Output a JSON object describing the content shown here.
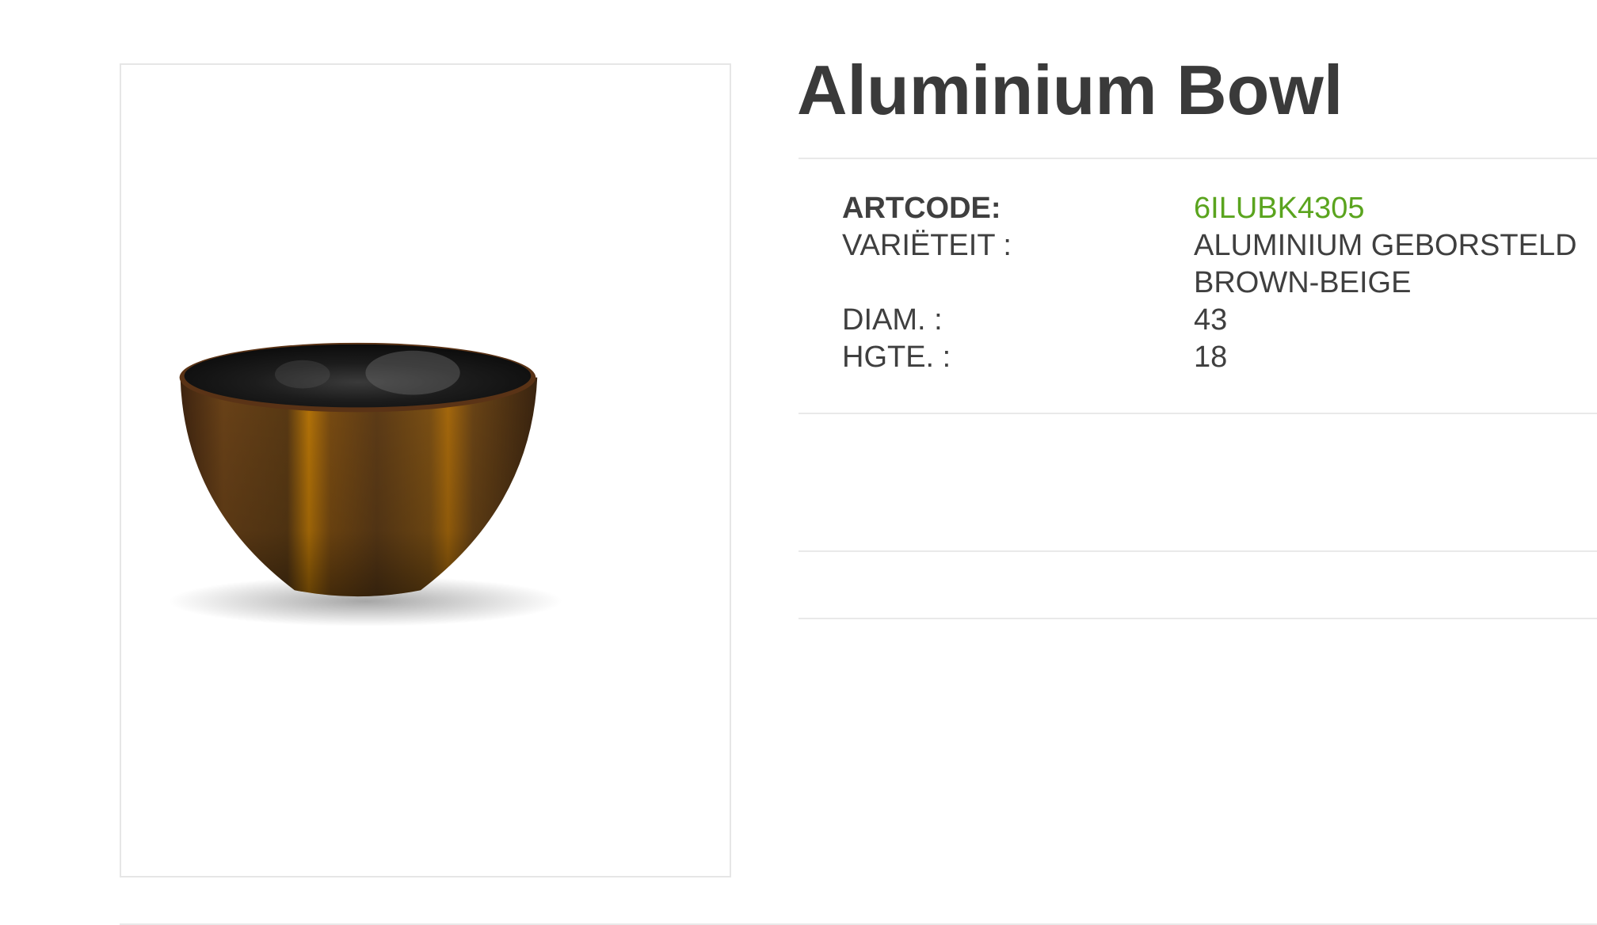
{
  "product": {
    "title": "Aluminium Bowl",
    "image_alt": "bowl-photo"
  },
  "specs": {
    "artcode_label": "ARTCODE:",
    "artcode_value": "6ILUBK4305",
    "variety_label": "VARIËTEIT :",
    "variety_value_line1": "ALUMINIUM GEBORSTELD",
    "variety_value_line2": "BROWN-BEIGE",
    "diam_label": "DIAM. :",
    "diam_value": "43",
    "height_label": "HGTE. :",
    "height_value": "18"
  },
  "colors": {
    "accent_green": "#5aa41e",
    "text": "#3a3a3a",
    "divider": "#e9e9e9"
  }
}
